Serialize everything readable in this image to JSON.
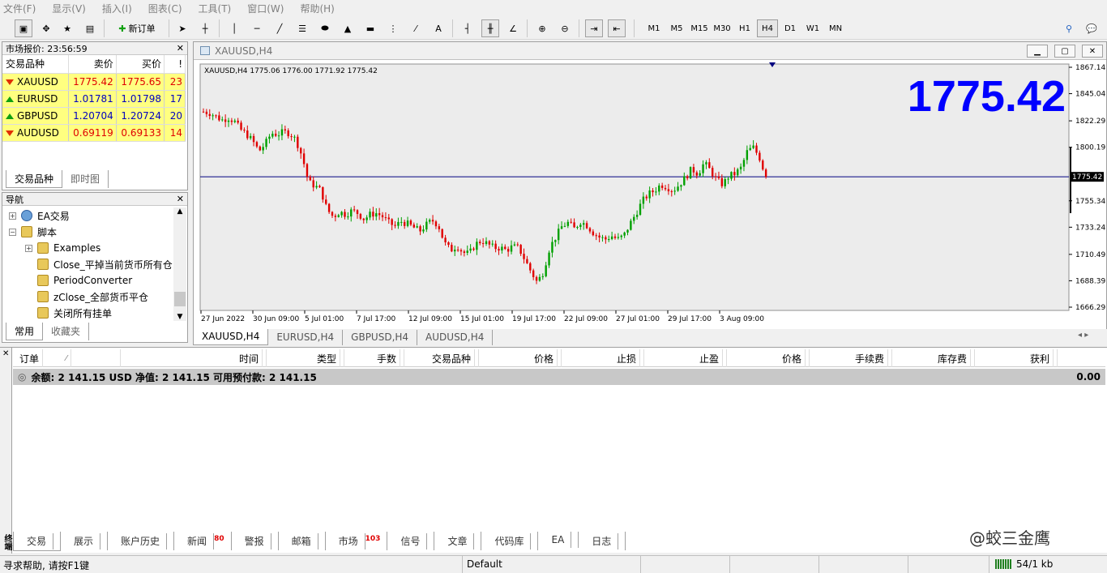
{
  "menu": [
    "文件(F)",
    "显示(V)",
    "插入(I)",
    "图表(C)",
    "工具(T)",
    "窗口(W)",
    "帮助(H)"
  ],
  "toolbar": {
    "new_order": "新订单",
    "tools": [
      "A"
    ],
    "timeframes": [
      "M1",
      "M5",
      "M15",
      "M30",
      "H1",
      "H4",
      "D1",
      "W1",
      "MN"
    ],
    "selected_timeframe": "H4"
  },
  "market_watch": {
    "title": "市场报价: 23:56:59",
    "headers": [
      "交易品种",
      "卖价",
      "买价",
      "!"
    ],
    "rows": [
      {
        "symbol": "XAUUSD",
        "bid": "1775.42",
        "ask": "1775.65",
        "spread": "23",
        "dir": "down",
        "color": "red"
      },
      {
        "symbol": "EURUSD",
        "bid": "1.01781",
        "ask": "1.01798",
        "spread": "17",
        "dir": "up",
        "color": "blue"
      },
      {
        "symbol": "GBPUSD",
        "bid": "1.20704",
        "ask": "1.20724",
        "spread": "20",
        "dir": "up",
        "color": "blue"
      },
      {
        "symbol": "AUDUSD",
        "bid": "0.69119",
        "ask": "0.69133",
        "spread": "14",
        "dir": "down",
        "color": "red"
      }
    ],
    "tabs": [
      "交易品种",
      "即时图"
    ]
  },
  "navigator": {
    "title": "导航",
    "items": [
      "EA交易",
      "脚本",
      "Examples",
      "Close_平掉当前货币所有仓",
      "PeriodConverter",
      "zClose_全部货币平仓",
      "关闭所有挂单"
    ],
    "tabs": [
      "常用",
      "收藏夹"
    ]
  },
  "chart": {
    "window_title": "XAUUSD,H4",
    "info": "XAUUSD,H4  1775.06 1776.00 1771.92 1775.42",
    "big_price": "1775.42",
    "current_price_label": "1775.42",
    "price_labels": [
      "1867.14",
      "1845.04",
      "1822.29",
      "1800.19",
      "1775.42",
      "1755.34",
      "1733.24",
      "1710.49",
      "1688.39",
      "1666.29"
    ],
    "time_labels": [
      "27 Jun 2022",
      "30 Jun 09:00",
      "5 Jul 01:00",
      "7 Jul 17:00",
      "12 Jul 09:00",
      "15 Jul 01:00",
      "19 Jul 17:00",
      "22 Jul 09:00",
      "27 Jul 01:00",
      "29 Jul 17:00",
      "3 Aug 09:00"
    ],
    "colors": {
      "bull": "#00a000",
      "bear": "#e00000",
      "price_line": "#000080",
      "big_price": "#0000ff"
    }
  },
  "chart_tabs": [
    "XAUUSD,H4",
    "EURUSD,H4",
    "GBPUSD,H4",
    "AUDUSD,H4"
  ],
  "chart_data": {
    "type": "candlestick",
    "title": "XAUUSD,H4",
    "close_path": [
      1830,
      1829,
      1826,
      1823,
      1825,
      1822,
      1815,
      1811,
      1805,
      1797,
      1803,
      1812,
      1811,
      1813,
      1812,
      1806,
      1792,
      1771,
      1768,
      1764,
      1748,
      1742,
      1746,
      1744,
      1747,
      1745,
      1740,
      1744,
      1745,
      1742,
      1737,
      1734,
      1738,
      1736,
      1733,
      1730,
      1735,
      1739,
      1735,
      1720,
      1714,
      1718,
      1712,
      1711,
      1719,
      1722,
      1719,
      1716,
      1716,
      1714,
      1717,
      1716,
      1706,
      1696,
      1687,
      1696,
      1716,
      1725,
      1734,
      1737,
      1732,
      1738,
      1735,
      1729,
      1725,
      1723,
      1726,
      1723,
      1726,
      1736,
      1745,
      1755,
      1761,
      1764,
      1769,
      1767,
      1764,
      1769,
      1775,
      1782,
      1778,
      1787,
      1781,
      1773,
      1769,
      1776,
      1778,
      1783,
      1797,
      1800,
      1791,
      1775
    ],
    "ylim": [
      1666.29,
      1867.14
    ],
    "last": 1775.42
  },
  "terminal": {
    "headers": [
      "订单",
      "时间",
      "类型",
      "手数",
      "交易品种",
      "价格",
      "止损",
      "止盈",
      "价格",
      "手续费",
      "库存费",
      "获利"
    ],
    "balance_text": "余额: 2 141.15 USD  净值: 2 141.15  可用预付款: 2 141.15",
    "profit": "0.00",
    "tabs": [
      {
        "label": "交易"
      },
      {
        "label": "展示"
      },
      {
        "label": "账户历史"
      },
      {
        "label": "新闻",
        "badge": "80"
      },
      {
        "label": "警报"
      },
      {
        "label": "邮箱"
      },
      {
        "label": "市场",
        "badge": "103"
      },
      {
        "label": "信号"
      },
      {
        "label": "文章"
      },
      {
        "label": "代码库"
      },
      {
        "label": "EA"
      },
      {
        "label": "日志"
      }
    ],
    "side_label": "终端"
  },
  "status": {
    "help": "寻求帮助, 请按F1键",
    "profile": "Default",
    "traffic": "54/1 kb"
  },
  "watermark": "@蛟三金鹰"
}
